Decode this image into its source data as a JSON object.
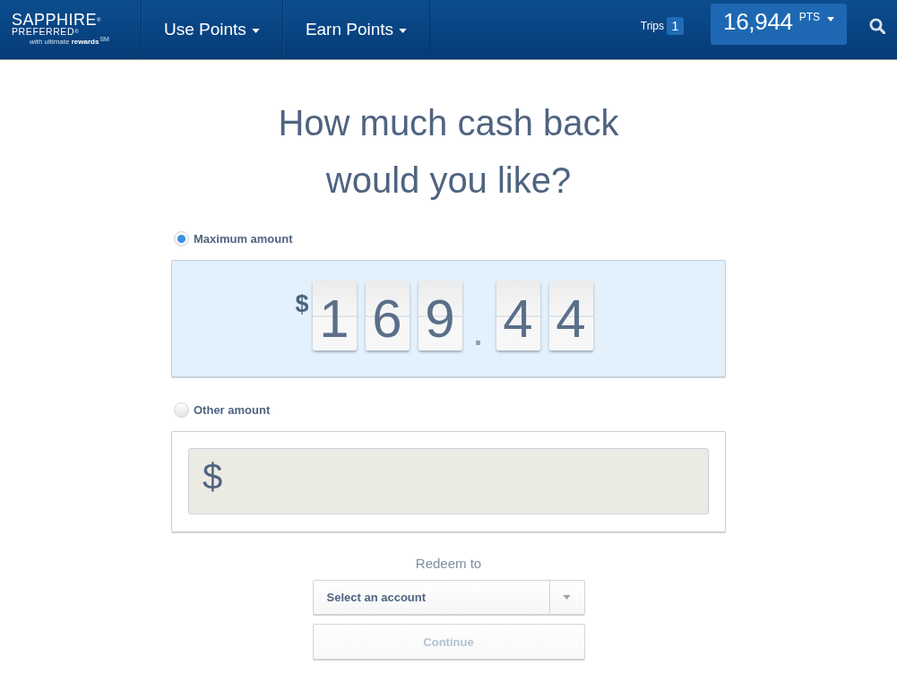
{
  "header": {
    "logo": {
      "wordmark": "SAPPHIRE$^{®}$",
      "subtitle": "PREFERRED$^{®}$",
      "tagline": "*with* ultimate **rewards**$^{SM}$"
    },
    "nav": [
      {
        "label": "Use Points"
      },
      {
        "label": "Earn Points"
      }
    ],
    "trips": {
      "label": "Trips",
      "count": "1"
    },
    "points": {
      "value": "16,944",
      "unit": "PTS"
    }
  },
  "title": "How much cash back would you like?",
  "options": [
    {
      "kind": "maximum",
      "label": "Maximum amount",
      "selected": true,
      "currency": "$",
      "digits": [
        {
          "kind": "digit",
          "text": "1"
        },
        {
          "kind": "digit",
          "text": "6"
        },
        {
          "kind": "digit",
          "text": "9"
        },
        {
          "kind": "separator",
          "text": "."
        },
        {
          "kind": "digit",
          "text": "4"
        },
        {
          "kind": "digit",
          "text": "4"
        }
      ]
    },
    {
      "kind": "other",
      "label": "Other amount",
      "selected": false,
      "currency": "$"
    }
  ],
  "redeem": {
    "label": "Redeem to",
    "select_placeholder": "Select an account"
  },
  "continue_button": {
    "label": "Continue",
    "disabled": true
  }
}
